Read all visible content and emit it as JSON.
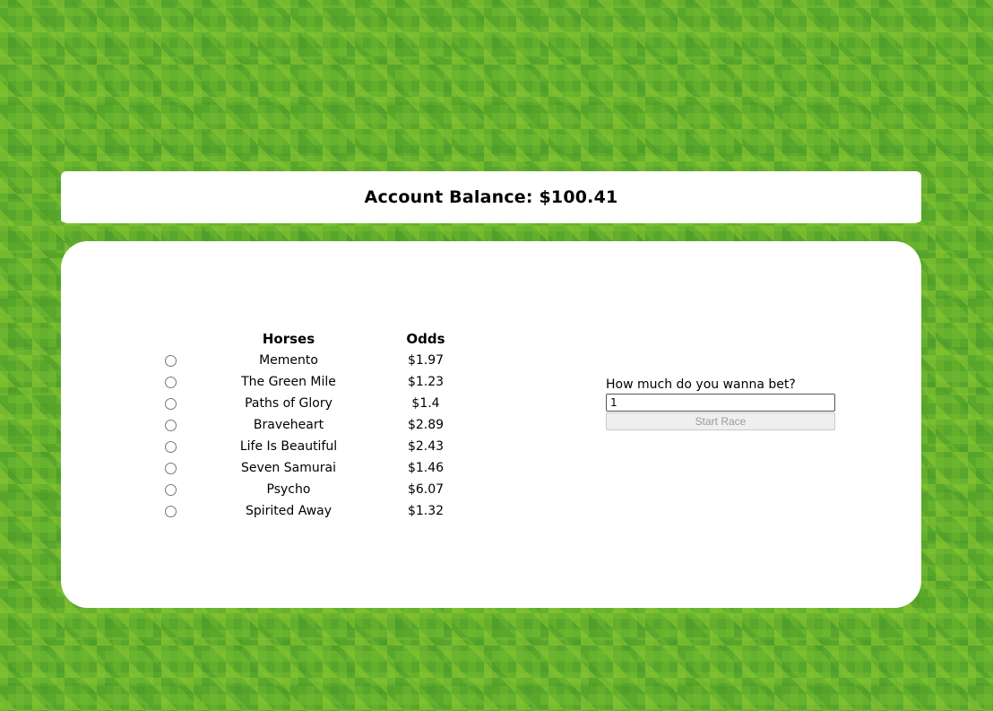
{
  "header": {
    "balance_text": "Account Balance: $100.41"
  },
  "table": {
    "columns": [
      "Horses",
      "Odds"
    ],
    "rows": [
      {
        "name": "Memento",
        "odds": "$1.97"
      },
      {
        "name": "The Green Mile",
        "odds": "$1.23"
      },
      {
        "name": "Paths of Glory",
        "odds": "$1.4"
      },
      {
        "name": "Braveheart",
        "odds": "$2.89"
      },
      {
        "name": "Life Is Beautiful",
        "odds": "$2.43"
      },
      {
        "name": "Seven Samurai",
        "odds": "$1.46"
      },
      {
        "name": "Psycho",
        "odds": "$6.07"
      },
      {
        "name": "Spirited Away",
        "odds": "$1.32"
      }
    ]
  },
  "bet": {
    "label": "How much do you wanna bet?",
    "value": "1",
    "start_label": "Start Race"
  },
  "colors": {
    "background_green": "#66b22f",
    "panel": "#ffffff"
  }
}
